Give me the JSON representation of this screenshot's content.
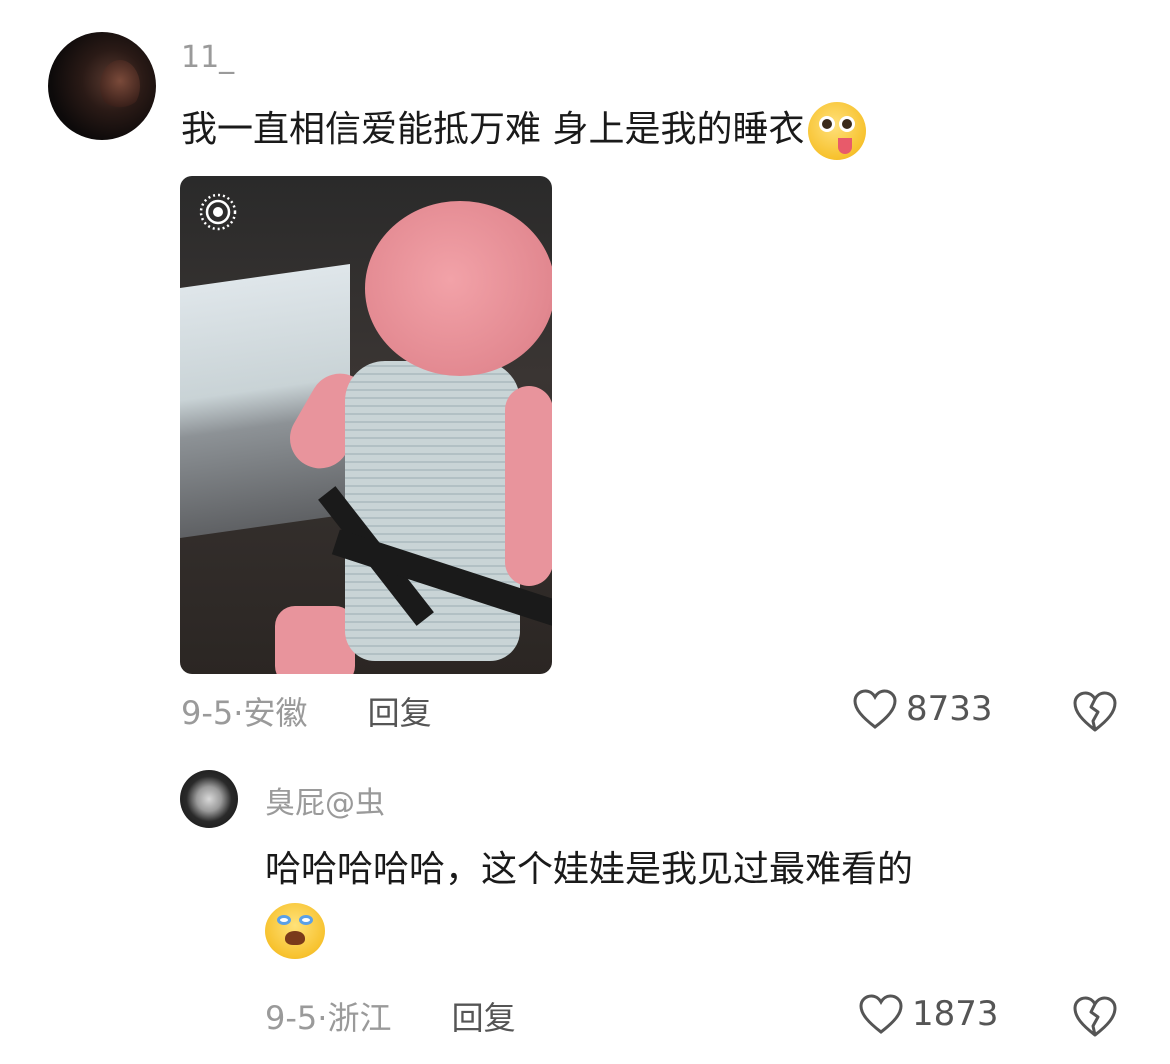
{
  "comment": {
    "username": "11_",
    "text": "我一直相信爱能抵万难 身上是我的睡衣",
    "emoji": "tongue-out-dizzy-emoji",
    "date": "9-5",
    "separator": "·",
    "location": "安徽",
    "reply_label": "回复",
    "likes": "8733"
  },
  "reply": {
    "username": "臭屁@虫",
    "text": "哈哈哈哈哈，这个娃娃是我见过最难看的",
    "emoji": "crying-laughing-emoji",
    "date": "9-5",
    "separator": "·",
    "location": "浙江",
    "reply_label": "回复",
    "likes": "1873"
  }
}
